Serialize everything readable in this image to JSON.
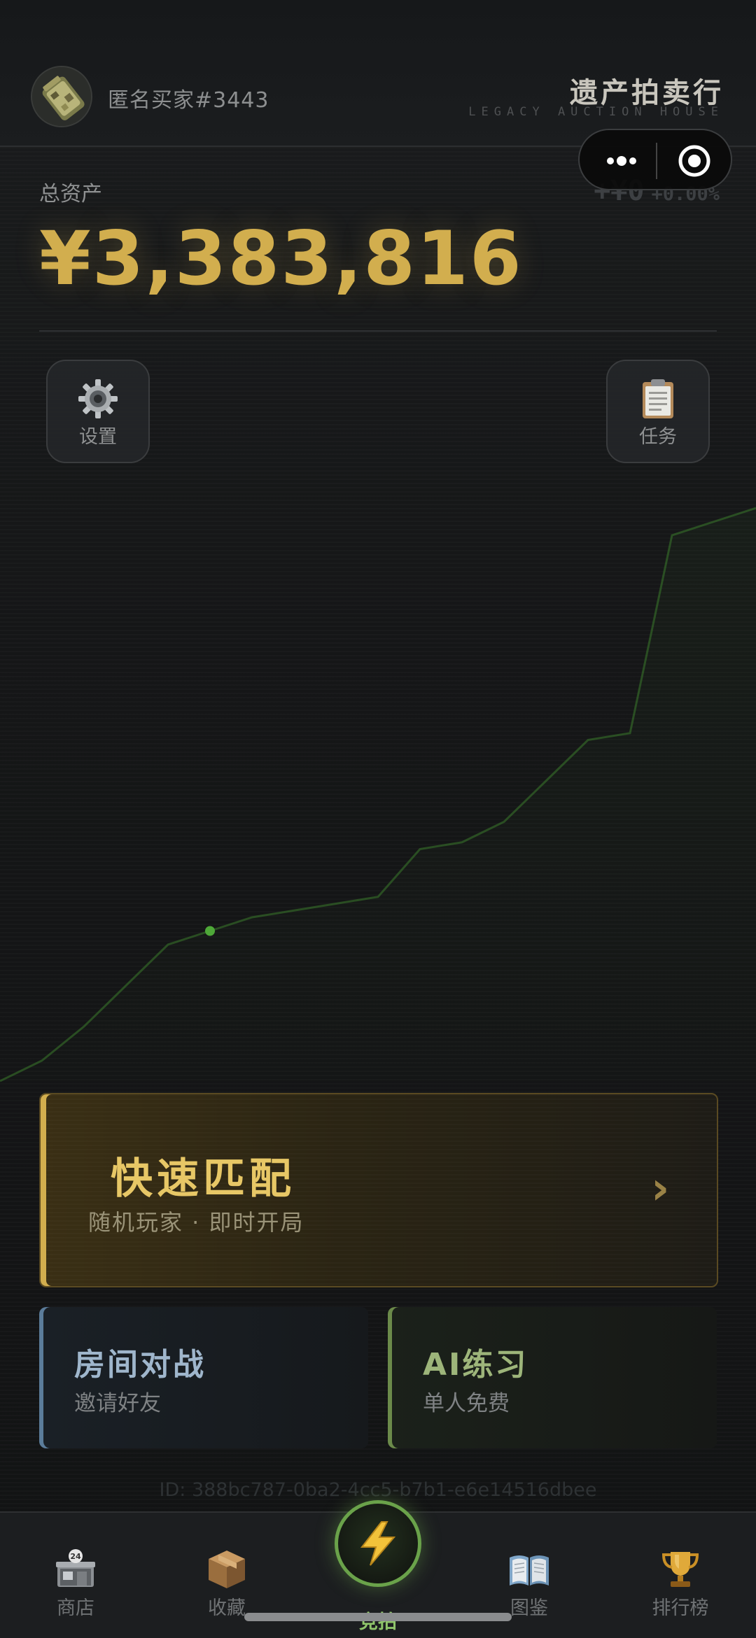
{
  "header": {
    "player_name": "匿名买家#3443",
    "brand_title": "遗产拍卖行",
    "brand_subtitle": "LEGACY AUCTION HOUSE"
  },
  "capsule": {
    "more_icon": "more-dots-icon",
    "close_icon": "target-close-icon"
  },
  "assets": {
    "label": "总资产",
    "total": "¥3,383,816",
    "delta_amount": "+¥0",
    "delta_percent": "+0.00%",
    "accent_color": "#d2ae4e"
  },
  "buttons": {
    "settings_label": "设置",
    "settings_icon": "gear-icon",
    "tasks_label": "任务",
    "tasks_icon": "clipboard-icon"
  },
  "quick_match": {
    "title": "快速匹配",
    "subtitle": "随机玩家 · 即时开局",
    "arrow": "›"
  },
  "modes": [
    {
      "title": "房间对战",
      "subtitle": "邀请好友",
      "accent": "#5b7c9a"
    },
    {
      "title": "AI练习",
      "subtitle": "单人免费",
      "accent": "#6b8a4a"
    }
  ],
  "session_id": "ID: 388bc787-0ba2-4cc5-b7b1-e6e14516dbee",
  "tabbar": {
    "tabs": [
      {
        "label": "商店",
        "icon": "shop-icon"
      },
      {
        "label": "收藏",
        "icon": "box-icon"
      },
      {
        "label": "竞拍",
        "icon": "lightning-icon",
        "active": true
      },
      {
        "label": "图鉴",
        "icon": "book-icon"
      },
      {
        "label": "排行榜",
        "icon": "trophy-icon"
      }
    ],
    "active_color": "#8fc46a"
  },
  "chart_data": {
    "type": "line",
    "series": [
      {
        "values": [
          0.0,
          0.03,
          0.08,
          0.14,
          0.2,
          0.22,
          0.24,
          0.25,
          0.26,
          0.27,
          0.34,
          0.35,
          0.38,
          0.44,
          0.5,
          0.51,
          0.8,
          0.82,
          0.84
        ]
      }
    ],
    "highlight_index": 5,
    "color": "#3a7a2c",
    "grid": false
  }
}
